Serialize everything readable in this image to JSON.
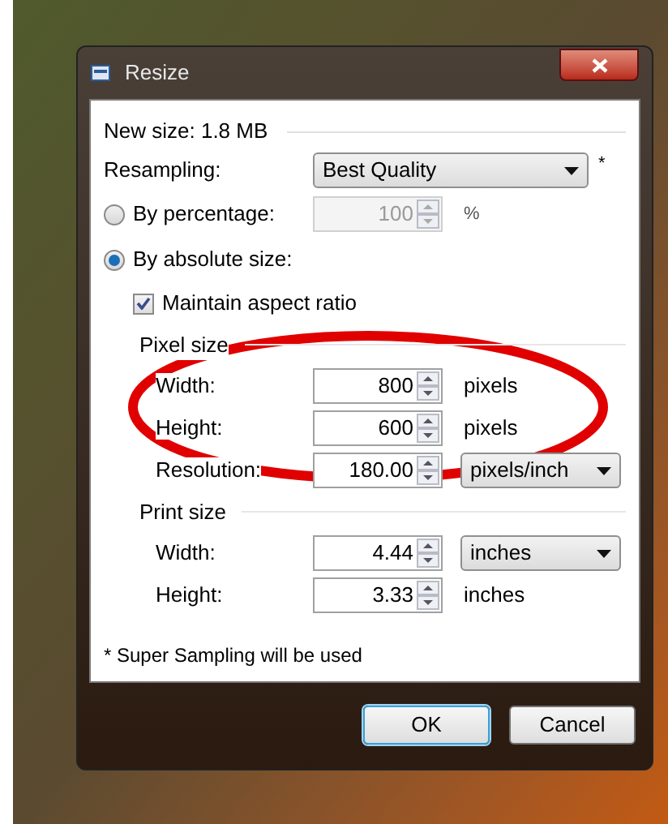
{
  "window": {
    "title": "Resize"
  },
  "new_size": "New size: 1.8 MB",
  "resampling": {
    "label": "Resampling:",
    "value": "Best Quality",
    "note": "*"
  },
  "modes": [
    {
      "label": "By percentage:",
      "selected": false
    },
    {
      "label": "By absolute size:",
      "selected": true
    }
  ],
  "percentage": {
    "value": "100",
    "unit": "%",
    "disabled": true
  },
  "maintain_aspect": {
    "label": "Maintain aspect ratio",
    "checked": true
  },
  "pixel_size": {
    "title": "Pixel size",
    "rows": [
      {
        "label": "Width:",
        "value": "800",
        "unit": "pixels",
        "kind": "text"
      },
      {
        "label": "Height:",
        "value": "600",
        "unit": "pixels",
        "kind": "text"
      },
      {
        "label": "Resolution:",
        "value": "180.00",
        "unit": "pixels/inch",
        "kind": "dropdown"
      }
    ]
  },
  "print_size": {
    "title": "Print size",
    "rows": [
      {
        "label": "Width:",
        "value": "4.44",
        "unit": "inches",
        "kind": "dropdown"
      },
      {
        "label": "Height:",
        "value": "3.33",
        "unit": "inches",
        "kind": "text"
      }
    ]
  },
  "footnote": "* Super Sampling will be used",
  "buttons": [
    {
      "label": "OK",
      "default": true
    },
    {
      "label": "Cancel",
      "default": false
    }
  ]
}
